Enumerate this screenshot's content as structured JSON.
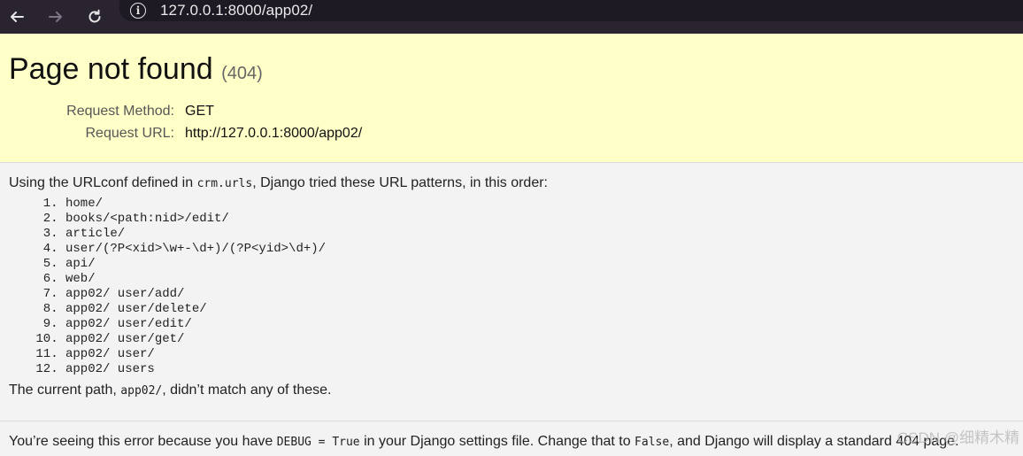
{
  "browser": {
    "url": "127.0.0.1:8000/app02/",
    "back_icon": "arrow-left-icon",
    "forward_icon": "arrow-right-icon",
    "reload_icon": "reload-icon",
    "site_info_icon": "info-icon"
  },
  "summary": {
    "title": "Page not found",
    "status_code": "(404)",
    "request_method_label": "Request Method:",
    "request_method_value": "GET",
    "request_url_label": "Request URL:",
    "request_url_value": "http://127.0.0.1:8000/app02/"
  },
  "info": {
    "intro_before": "Using the URLconf defined in ",
    "intro_code": "crm.urls",
    "intro_after": ", Django tried these URL patterns, in this order:",
    "patterns": [
      "home/",
      "books/<path:nid>/edit/",
      "article/",
      "user/(?P<xid>\\w+-\\d+)/(?P<yid>\\d+)/",
      "api/",
      "web/",
      "app02/ user/add/",
      "app02/ user/delete/",
      "app02/ user/edit/",
      "app02/ user/get/",
      "app02/ user/",
      "app02/ users"
    ],
    "current_before": "The current path, ",
    "current_code": "app02/",
    "current_after": ", didn’t match any of these."
  },
  "explanation": {
    "text_before": "You’re seeing this error because you have ",
    "code1": "DEBUG = True",
    "text_mid": " in your Django settings file. Change that to ",
    "code2": "False",
    "text_after": ", and Django will display a standard 404 page."
  },
  "watermark": "CSDN @细精木精",
  "colors": {
    "summary_bg": "#ffffc8",
    "body_bg": "#f3f3f3",
    "browser_bg": "#2a2330"
  }
}
